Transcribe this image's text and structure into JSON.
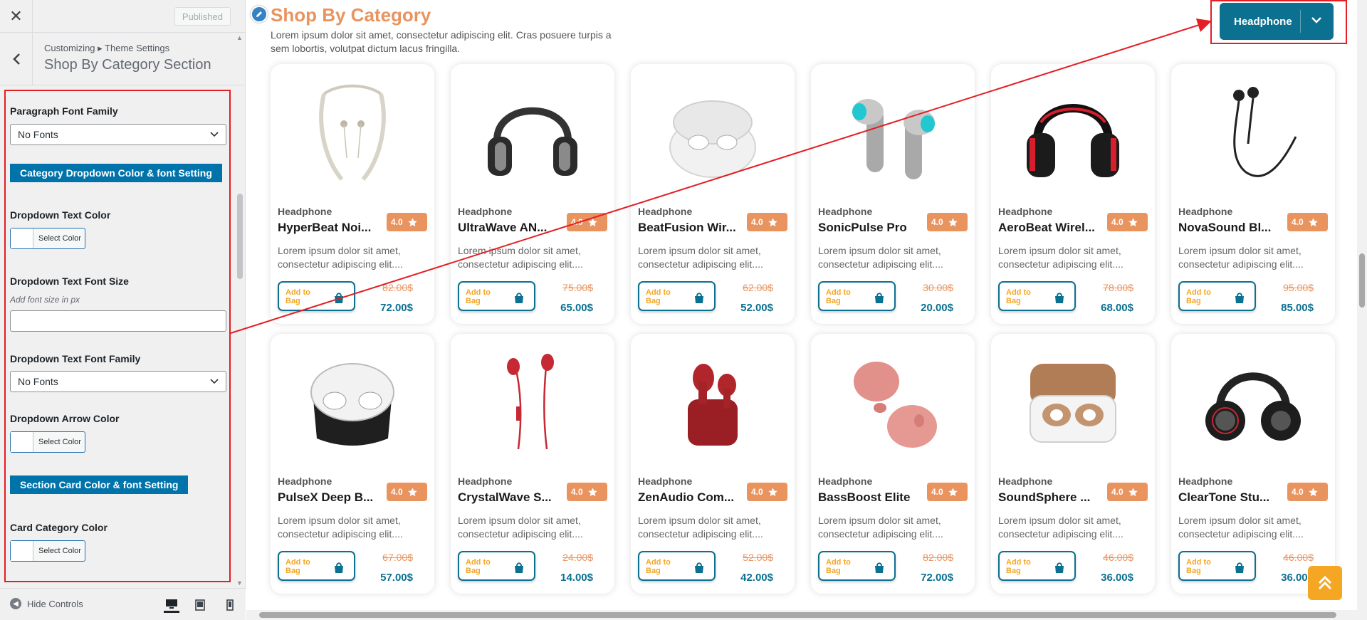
{
  "sidebar": {
    "close_label": "✕",
    "published_label": "Published",
    "breadcrumb": "Customizing ▸ Theme Settings",
    "section_title": "Shop By Category Section",
    "paragraph_font_family_label": "Paragraph Font Family",
    "paragraph_font_family_value": "No Fonts",
    "category_dropdown_banner": "Category Dropdown Color & font Setting",
    "dropdown_text_color_label": "Dropdown Text Color",
    "select_color_label": "Select Color",
    "dropdown_font_size_label": "Dropdown Text Font Size",
    "dropdown_font_size_hint": "Add font size in px",
    "dropdown_font_size_value": "",
    "dropdown_font_family_label": "Dropdown Text Font Family",
    "dropdown_font_family_value": "No Fonts",
    "dropdown_arrow_color_label": "Dropdown Arrow Color",
    "section_card_banner": "Section Card Color & font Setting",
    "card_category_color_label": "Card Category Color",
    "hide_controls_label": "Hide Controls",
    "devices": [
      "desktop-icon",
      "tablet-icon",
      "mobile-icon"
    ]
  },
  "main": {
    "title": "Shop By Category",
    "description": "Lorem ipsum dolor sit amet, consectetur adipiscing elit. Cras posuere turpis a sem lobortis, volutpat dictum lacus fringilla.",
    "category_dropdown_value": "Headphone",
    "colors": {
      "accent": "#e9945f",
      "primary": "#0c7090",
      "bag_text": "#f5a623",
      "highlight": "#e31e24"
    },
    "products": [
      {
        "category": "Headphone",
        "name": "HyperBeat Noi...",
        "rating": "4.0",
        "desc": "Lorem ipsum dolor sit amet, consectetur adipiscing elit....",
        "old_price": "82.00$",
        "new_price": "72.00$",
        "bag_label": "Add to Bag",
        "icon": "neckband-earphones-image"
      },
      {
        "category": "Headphone",
        "name": "UltraWave AN...",
        "rating": "4.0",
        "desc": "Lorem ipsum dolor sit amet, consectetur adipiscing elit....",
        "old_price": "75.00$",
        "new_price": "65.00$",
        "bag_label": "Add to Bag",
        "icon": "over-ear-headphones-image"
      },
      {
        "category": "Headphone",
        "name": "BeatFusion Wir...",
        "rating": "4.0",
        "desc": "Lorem ipsum dolor sit amet, consectetur adipiscing elit....",
        "old_price": "62.00$",
        "new_price": "52.00$",
        "bag_label": "Add to Bag",
        "icon": "earbuds-case-image"
      },
      {
        "category": "Headphone",
        "name": "SonicPulse Pro",
        "rating": "4.0",
        "desc": "Lorem ipsum dolor sit amet, consectetur adipiscing elit....",
        "old_price": "30.00$",
        "new_price": "20.00$",
        "bag_label": "Add to Bag",
        "icon": "earbuds-image"
      },
      {
        "category": "Headphone",
        "name": "AeroBeat Wirel...",
        "rating": "4.0",
        "desc": "Lorem ipsum dolor sit amet, consectetur adipiscing elit....",
        "old_price": "78.00$",
        "new_price": "68.00$",
        "bag_label": "Add to Bag",
        "icon": "gaming-headphones-image"
      },
      {
        "category": "Headphone",
        "name": "NovaSound Bl...",
        "rating": "4.0",
        "desc": "Lorem ipsum dolor sit amet, consectetur adipiscing elit....",
        "old_price": "95.00$",
        "new_price": "85.00$",
        "bag_label": "Add to Bag",
        "icon": "wired-earphones-image"
      },
      {
        "category": "Headphone",
        "name": "PulseX Deep B...",
        "rating": "4.0",
        "desc": "Lorem ipsum dolor sit amet, consectetur adipiscing elit....",
        "old_price": "67.00$",
        "new_price": "57.00$",
        "bag_label": "Add to Bag",
        "icon": "earbuds-case-black-image"
      },
      {
        "category": "Headphone",
        "name": "CrystalWave S...",
        "rating": "4.0",
        "desc": "Lorem ipsum dolor sit amet, consectetur adipiscing elit....",
        "old_price": "24.00$",
        "new_price": "14.00$",
        "bag_label": "Add to Bag",
        "icon": "red-wired-earphones-image"
      },
      {
        "category": "Headphone",
        "name": "ZenAudio Com...",
        "rating": "4.0",
        "desc": "Lorem ipsum dolor sit amet, consectetur adipiscing elit....",
        "old_price": "52.00$",
        "new_price": "42.00$",
        "bag_label": "Add to Bag",
        "icon": "red-earbuds-image"
      },
      {
        "category": "Headphone",
        "name": "BassBoost Elite",
        "rating": "4.0",
        "desc": "Lorem ipsum dolor sit amet, consectetur adipiscing elit....",
        "old_price": "82.00$",
        "new_price": "72.00$",
        "bag_label": "Add to Bag",
        "icon": "pink-earbuds-image"
      },
      {
        "category": "Headphone",
        "name": "SoundSphere ...",
        "rating": "4.0",
        "desc": "Lorem ipsum dolor sit amet, consectetur adipiscing elit....",
        "old_price": "46.00$",
        "new_price": "36.00$",
        "bag_label": "Add to Bag",
        "icon": "gold-earbuds-case-image"
      },
      {
        "category": "Headphone",
        "name": "ClearTone Stu...",
        "rating": "4.0",
        "desc": "Lorem ipsum dolor sit amet, consectetur adipiscing elit....",
        "old_price": "46.00$",
        "new_price": "36.00$",
        "bag_label": "Add to Bag",
        "icon": "studio-headphones-image"
      }
    ]
  }
}
